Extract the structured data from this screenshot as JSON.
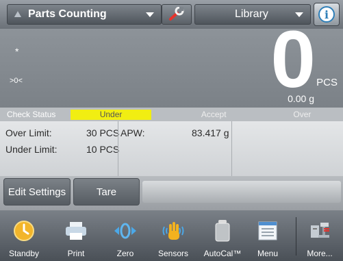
{
  "topbar": {
    "app_name": "Parts Counting",
    "library_label": "Library",
    "info_label": "i"
  },
  "display": {
    "stable_indicator": "*",
    "center_zero_indicator": ">0<",
    "main_value": "0",
    "main_unit": "PCS",
    "secondary_value": "0.00 g"
  },
  "check_status": {
    "title": "Check Status",
    "under": "Under",
    "accept": "Accept",
    "over": "Over",
    "active_color": "#f1ee12"
  },
  "info": {
    "over_limit_label": "Over Limit:",
    "over_limit_value": "30 PCS",
    "under_limit_label": "Under Limit:",
    "under_limit_value": "10 PCS",
    "apw_label": "APW:",
    "apw_value": "83.417 g"
  },
  "actions": {
    "edit_settings": "Edit Settings",
    "tare": "Tare"
  },
  "nav": {
    "items": [
      {
        "label": "Standby",
        "icon": "standby-icon"
      },
      {
        "label": "Print",
        "icon": "printer-icon"
      },
      {
        "label": "Zero",
        "icon": "zero-icon"
      },
      {
        "label": "Sensors",
        "icon": "sensors-hand-icon"
      },
      {
        "label": "AutoCal™",
        "icon": "calibration-weight-icon"
      },
      {
        "label": "Menu",
        "icon": "menu-icon"
      },
      {
        "label": "More...",
        "icon": "more-icon"
      }
    ]
  }
}
